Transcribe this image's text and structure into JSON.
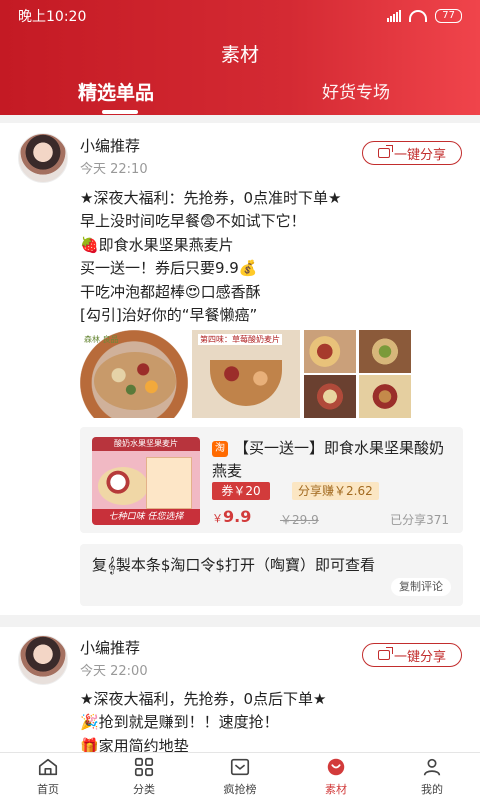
{
  "status_bar": {
    "time": "晚上10:20",
    "battery": "77"
  },
  "header": {
    "title": "素材",
    "tabs": [
      {
        "label": "精选单品",
        "active": true
      },
      {
        "label": "好货专场",
        "active": false
      }
    ]
  },
  "posts": [
    {
      "author": "小编推荐",
      "time": "今天 22:10",
      "share_label": "一键分享",
      "lines": [
        "★深夜大福利：先抢券，0点准时下单★",
        "早上没时间吃早餐😨不如试下它！",
        "🍓即食水果坚果燕麦片",
        "买一送一！券后只要9.9💰",
        "干吃冲泡都超棒😍口感香酥",
        "[勾引]治好你的“早餐懒癌”"
      ],
      "images": {
        "thumb1_brand": "森林 良品",
        "thumb2_head": "第四味：草莓酸奶麦片"
      },
      "product": {
        "image_top": "酸奶水果坚果麦片",
        "image_bottom": "七种口味 任您选择",
        "platform_icon": "淘",
        "title": "【买一送一】即食水果坚果酸奶燕麦",
        "coupon": "券￥20",
        "earn": "分享赚￥2.62",
        "price_symbol": "￥",
        "price": "9.9",
        "original_price": "￥29.9",
        "shared": "已分享371"
      },
      "code": {
        "text": "复𝄞製本条$淘口令$打开（啕寶）即可查看",
        "copy_label": "复制评论"
      }
    },
    {
      "author": "小编推荐",
      "time": "今天 22:00",
      "share_label": "一键分享",
      "lines": [
        "★深夜大福利，先抢券，0点后下单★",
        "🎉抢到就是赚到！！速度抢！",
        "🎁家用简约地垫"
      ]
    }
  ],
  "tabbar": [
    {
      "label": "首页",
      "icon": "home-icon",
      "active": false
    },
    {
      "label": "分类",
      "icon": "grid-icon",
      "active": false
    },
    {
      "label": "疯抢榜",
      "icon": "ranking-icon",
      "active": false
    },
    {
      "label": "素材",
      "icon": "material-icon",
      "active": true
    },
    {
      "label": "我的",
      "icon": "user-icon",
      "active": false
    }
  ],
  "colors": {
    "primary": "#c41a24",
    "accent": "#d23b3b"
  }
}
